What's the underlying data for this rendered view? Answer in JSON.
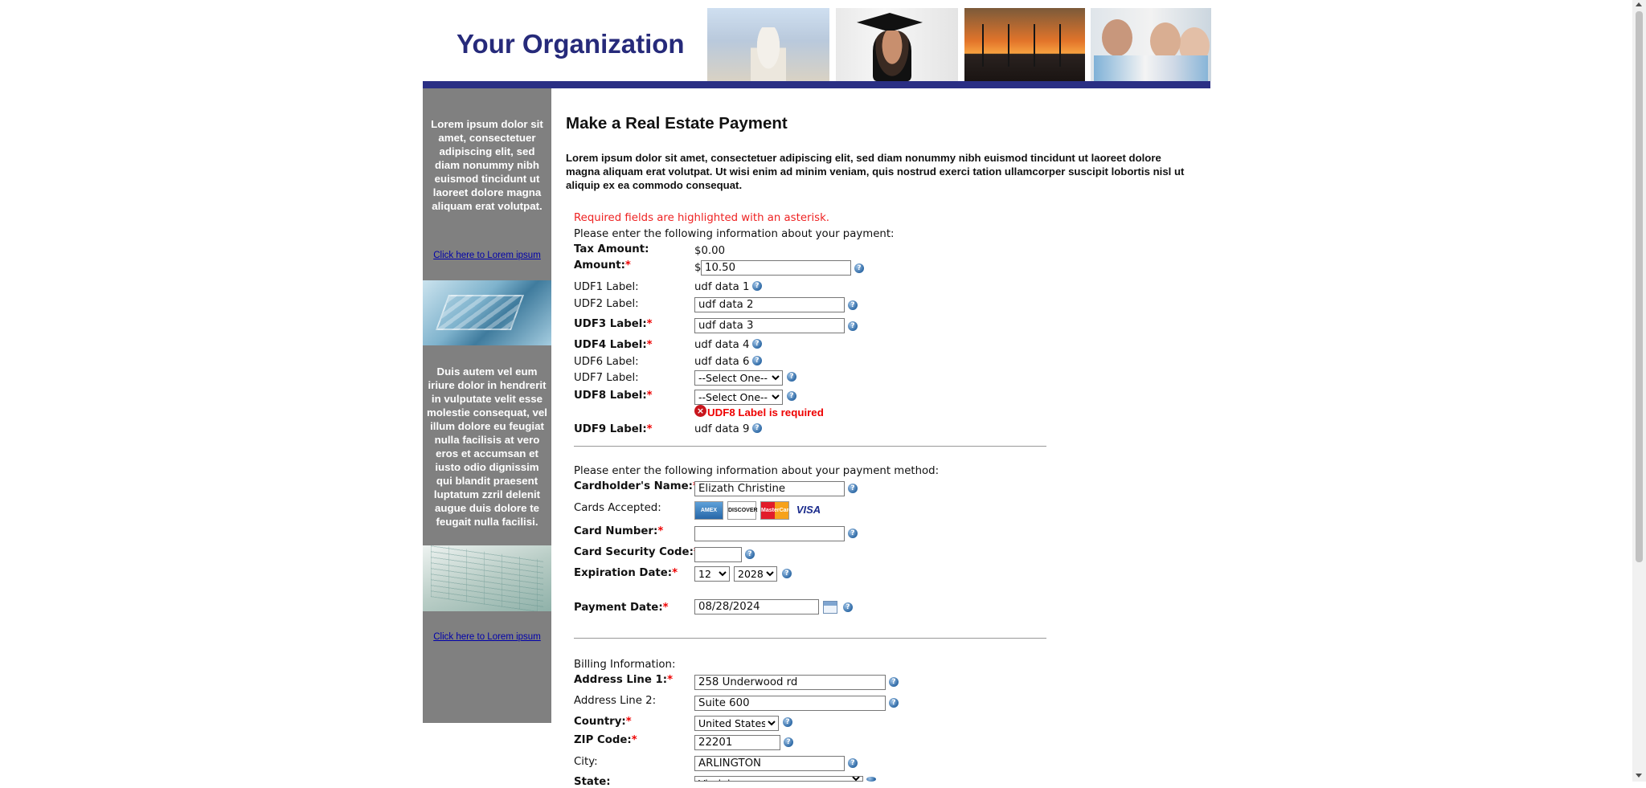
{
  "header": {
    "org_name": "Your Organization",
    "bar_color": "#2a2f84"
  },
  "sidebar": {
    "text1": "Lorem ipsum dolor sit amet, consectetuer adipiscing elit, sed diam nonummy nibh euismod tincidunt ut laoreet dolore magna aliquam erat volutpat.",
    "link1": "Click here to Lorem ipsum",
    "text2": "Duis autem vel eum iriure dolor in hendrerit in vulputate velit esse molestie consequat, vel illum dolore eu feugiat nulla facilisis at vero eros et accumsan et iusto odio dignissim qui blandit praesent luptatum zzril delenit augue duis dolore te feugait nulla facilisi.",
    "link2": "Click here to Lorem ipsum"
  },
  "main": {
    "title": "Make a Real Estate Payment",
    "intro": "Lorem ipsum dolor sit amet, consectetuer adipiscing elit, sed diam nonummy nibh euismod tincidunt ut laoreet dolore magna aliquam erat volutpat. Ut wisi enim ad minim veniam, quis nostrud exerci tation ullamcorper suscipit lobortis nisl ut aliquip ex ea commodo consequat."
  },
  "form": {
    "required_note": "Required fields are highlighted with an asterisk.",
    "payment_instructions": "Please enter the following information about your payment:",
    "asterisk": "*",
    "dollar_sign": "$",
    "tax_amount_label": "Tax Amount:",
    "tax_amount_value": "$0.00",
    "amount_label": "Amount:",
    "amount_value": "10.50",
    "udf1_label": "UDF1 Label:",
    "udf1_value": "udf data 1",
    "udf2_label": "UDF2 Label:",
    "udf2_value": "udf data 2",
    "udf3_label": "UDF3 Label:",
    "udf3_value": "udf data 3",
    "udf4_label": "UDF4 Label:",
    "udf4_value": "udf data 4",
    "udf6_label": "UDF6 Label:",
    "udf6_value": "udf data 6",
    "udf7_label": "UDF7 Label:",
    "udf7_selected": "--Select One--",
    "udf8_label": "UDF8 Label:",
    "udf8_selected": "--Select One--",
    "udf8_error": "UDF8 Label is required",
    "udf9_label": "UDF9 Label:",
    "udf9_value": "udf data 9",
    "method_instructions": "Please enter the following information about your payment method:",
    "cardholder_label": "Cardholder's Name:",
    "cardholder_value": "Elizath Christine",
    "cards_accepted_label": "Cards Accepted:",
    "cards": [
      "AMEX",
      "DISCOVER",
      "MasterCard",
      "VISA"
    ],
    "card_number_label": "Card Number:",
    "card_number_value": "",
    "security_code_label": "Card Security Code:",
    "security_code_value": "",
    "expiration_label": "Expiration Date:",
    "exp_month": "12",
    "exp_year": "2028",
    "payment_date_label": "Payment Date:",
    "payment_date_value": "08/28/2024",
    "billing_label": "Billing Information:",
    "address1_label": "Address Line 1:",
    "address1_value": "258 Underwood rd",
    "address2_label": "Address Line 2:",
    "address2_value": "Suite 600",
    "country_label": "Country:",
    "country_selected": "United States",
    "zip_label": "ZIP Code:",
    "zip_value": "22201",
    "city_label": "City:",
    "city_value": "ARLINGTON",
    "state_label": "State:",
    "state_selected": "Virginia"
  }
}
